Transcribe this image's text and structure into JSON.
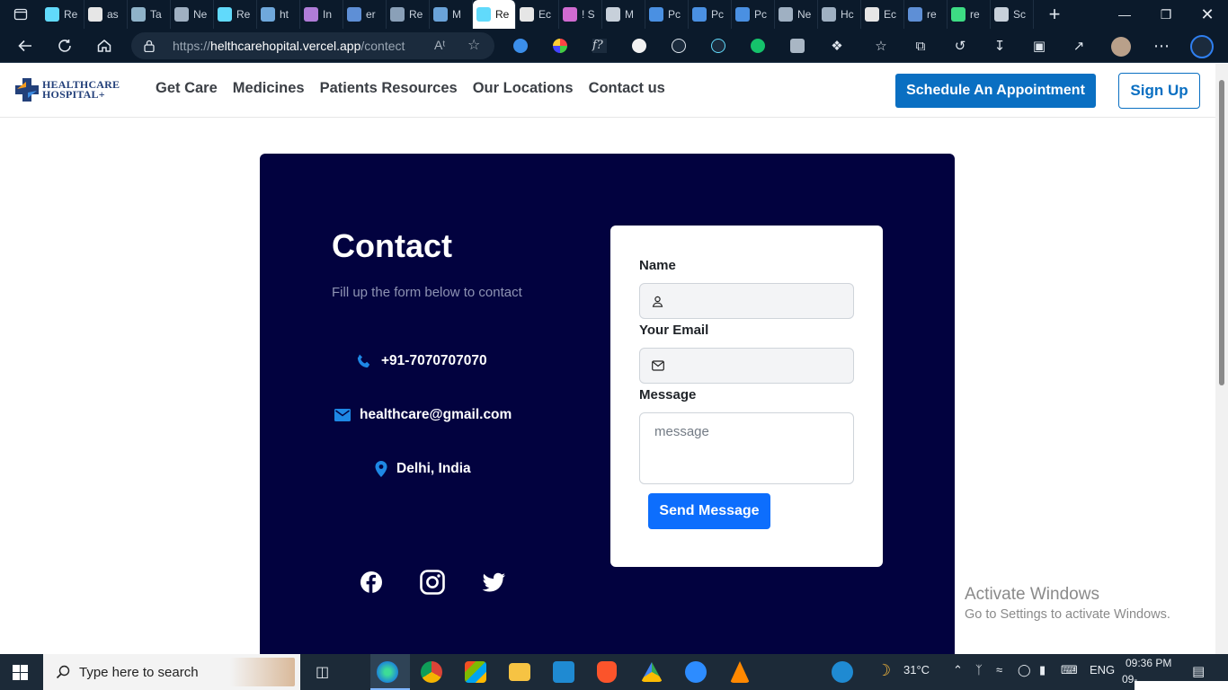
{
  "browser": {
    "tabs": [
      {
        "label": "Re",
        "color": "#61dafb"
      },
      {
        "label": "as",
        "color": "#e6e6e6"
      },
      {
        "label": "Ta",
        "color": "#8fb3c9"
      },
      {
        "label": "Ne",
        "color": "#9fb0c2"
      },
      {
        "label": "Re",
        "color": "#61dafb"
      },
      {
        "label": "ht",
        "color": "#6fa8dc"
      },
      {
        "label": "In",
        "color": "#b07cd8"
      },
      {
        "label": "er",
        "color": "#5e8fd6"
      },
      {
        "label": "Re",
        "color": "#8aa0b8"
      },
      {
        "label": "M",
        "color": "#6aa3d9"
      },
      {
        "label": "Re",
        "color": "#61dafb",
        "active": true
      },
      {
        "label": "Ec",
        "color": "#e6e6e6"
      },
      {
        "label": "! S",
        "color": "#d06bd0"
      },
      {
        "label": "M",
        "color": "#c7d0da"
      },
      {
        "label": "Pc",
        "color": "#4a90e2"
      },
      {
        "label": "Pc",
        "color": "#4a90e2"
      },
      {
        "label": "Pc",
        "color": "#4a90e2"
      },
      {
        "label": "Ne",
        "color": "#9fb0c2"
      },
      {
        "label": "Hc",
        "color": "#9fb0c2"
      },
      {
        "label": "Ec",
        "color": "#e6e6e6"
      },
      {
        "label": "re",
        "color": "#5e8fd6"
      },
      {
        "label": "re",
        "color": "#3ddc84"
      },
      {
        "label": "Sc",
        "color": "#c7d0da"
      }
    ],
    "url_prefix": "https://",
    "url_host": "helthcarehopital.vercel.app",
    "url_path": "/contect"
  },
  "site": {
    "logo_line1": "HEALTHCARE",
    "logo_line2": "HOSPITAL+",
    "nav": [
      "Get Care",
      "Medicines",
      "Patients Resources",
      "Our Locations",
      "Contact us"
    ],
    "schedule_label": "Schedule An Appointment",
    "signup_label": "Sign Up"
  },
  "contact": {
    "title": "Contact",
    "subtitle": "Fill up the form below to contact",
    "phone": "+91-7070707070",
    "email": "healthcare@gmail.com",
    "location": "Delhi, India",
    "socials": [
      "facebook-icon",
      "instagram-icon",
      "twitter-icon"
    ]
  },
  "form": {
    "name_label": "Name",
    "name_value": "",
    "email_label": "Your Email",
    "email_value": "",
    "message_label": "Message",
    "message_placeholder": "message",
    "send_label": "Send Message"
  },
  "watermark": {
    "line1": "Activate Windows",
    "line2": "Go to Settings to activate Windows."
  },
  "taskbar": {
    "search_placeholder": "Type here to search",
    "temperature": "31°C",
    "language": "ENG",
    "time": "09:36 PM",
    "date": "09-"
  },
  "colors": {
    "panel": "#02023f",
    "primary": "#0a6fc2",
    "send": "#0d6efd",
    "icon_blue": "#1e88e5"
  }
}
